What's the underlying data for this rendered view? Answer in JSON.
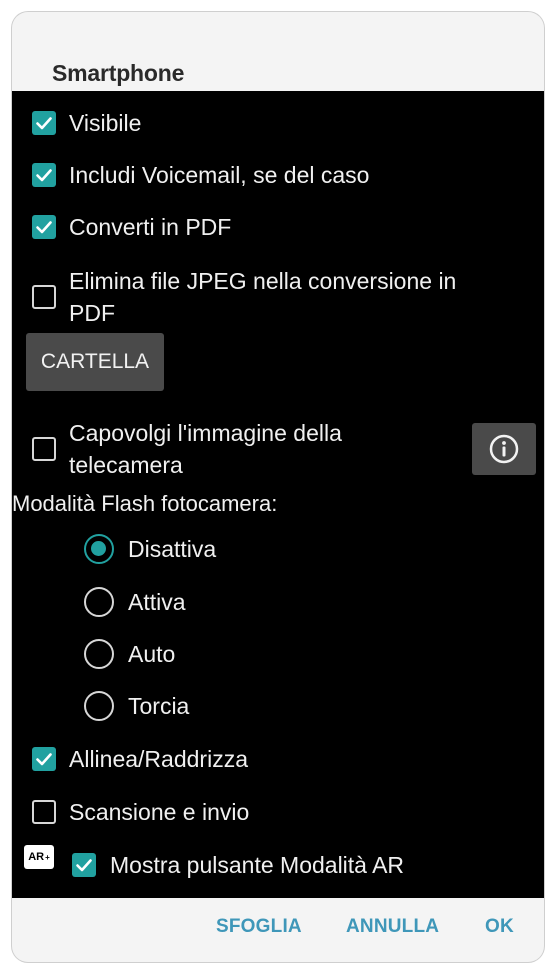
{
  "dialog": {
    "title": "Smartphone",
    "options": {
      "visibile": {
        "label": "Visibile",
        "checked": true
      },
      "voicemail": {
        "label": "Includi Voicemail, se del caso",
        "checked": true
      },
      "pdf": {
        "label": "Converti in PDF",
        "checked": true
      },
      "elimina": {
        "label_line1": "Elimina file JPEG nella conversione in",
        "label_line2": "PDF",
        "checked": false
      },
      "capovolgi": {
        "label_line1": "Capovolgi l'immagine della",
        "label_line2": "telecamera",
        "checked": false
      },
      "allinea": {
        "label": "Allinea/Raddrizza",
        "checked": true
      },
      "scansione": {
        "label": "Scansione e invio",
        "checked": false
      },
      "ar": {
        "label": "Mostra pulsante Modalità AR",
        "checked": true,
        "badge": "AR",
        "badge_sup": "+"
      }
    },
    "folder_button": "CARTELLA",
    "info_icon": "info-circle-icon",
    "flash": {
      "label": "Modalità Flash fotocamera:",
      "selected": "Disattiva",
      "choices": [
        "Disattiva",
        "Attiva",
        "Auto",
        "Torcia"
      ]
    },
    "footer": {
      "browse": "SFOGLIA",
      "cancel": "ANNULLA",
      "ok": "OK"
    }
  },
  "colors": {
    "accent": "#21a1a0",
    "footer_text": "#3f97b9",
    "button_bg": "#4a4a4a"
  }
}
